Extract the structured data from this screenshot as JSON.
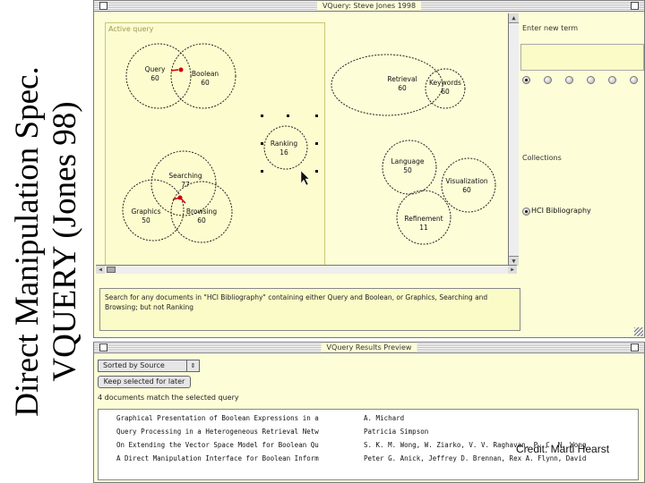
{
  "slide": {
    "title_line1": "Direct Manipulation Spec.",
    "title_line2": "VQUERY (Jones 98)",
    "credit": "Credit: Marti Hearst"
  },
  "main_window": {
    "title": "VQuery: Steve Jones 1998",
    "active_query_label": "Active query",
    "nodes": [
      {
        "id": "query",
        "label": "Query",
        "count": "60"
      },
      {
        "id": "boolean",
        "label": "Boolean",
        "count": "60"
      },
      {
        "id": "retrieval",
        "label": "Retrieval",
        "count": "60"
      },
      {
        "id": "keywords",
        "label": "Keywords",
        "count": "60"
      },
      {
        "id": "ranking",
        "label": "Ranking",
        "count": "16"
      },
      {
        "id": "searching",
        "label": "Searching",
        "count": "77"
      },
      {
        "id": "graphics",
        "label": "Graphics",
        "count": "50"
      },
      {
        "id": "browsing",
        "label": "Browsing",
        "count": "60"
      },
      {
        "id": "language",
        "label": "Language",
        "count": "50"
      },
      {
        "id": "visualization",
        "label": "Visualization",
        "count": "60"
      },
      {
        "id": "refinement",
        "label": "Refinement",
        "count": "11"
      }
    ],
    "enter_term_label": "Enter new term",
    "term_value": "",
    "collections_label": "Collections",
    "collection_selected": "HCI Bibliography",
    "description": "Search for any documents in \"HCI Bibliography\" containing either Query and Boolean, or Graphics, Searching and Browsing; but not Ranking"
  },
  "results_window": {
    "title": "VQuery Results Preview",
    "sort_label": "Sorted by Source",
    "keep_button": "Keep selected for later",
    "match_count": "4 documents match the selected query",
    "rows": [
      {
        "title": "Graphical Presentation of Boolean Expressions in a",
        "author": "A. Michard"
      },
      {
        "title": "Query Processing in a Heterogeneous Retrieval Netw",
        "author": "Patricia Simpson"
      },
      {
        "title": "On Extending the Vector Space Model for Boolean Qu",
        "author": "S. K. M. Wong, W. Ziarko, V. V. Raghavan, P. C. N. Wong"
      },
      {
        "title": "A Direct Manipulation Interface for Boolean Inform",
        "author": "Peter G. Anick, Jeffrey D. Brennan, Rex A. Flynn, David"
      }
    ]
  },
  "colors": {
    "window_bg": "#fdfdd8",
    "connector": "#cc0000"
  }
}
